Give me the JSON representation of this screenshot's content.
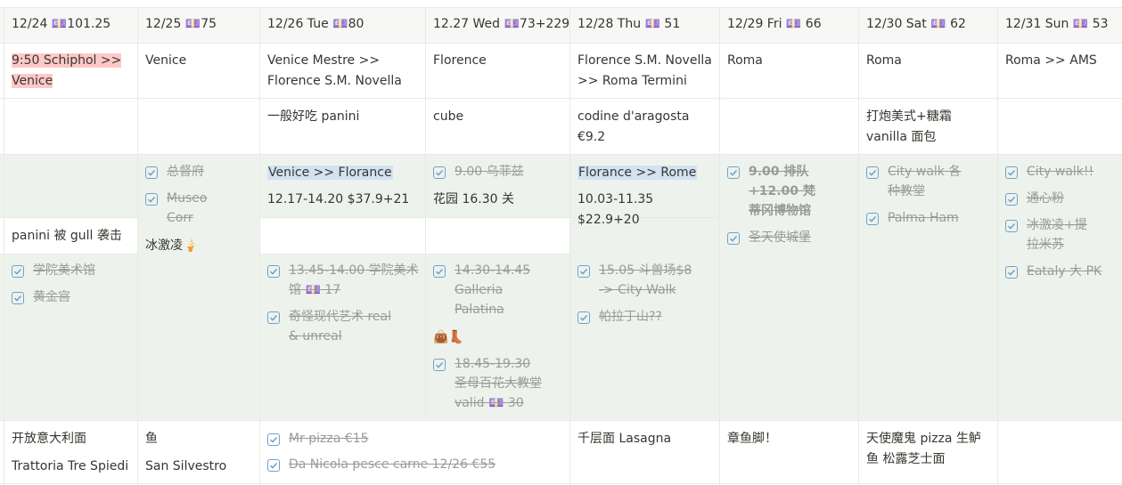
{
  "headers": [
    "12/24 💷101.25",
    "12/25 💷75",
    "12/26 Tue 💷80",
    "12.27 Wed 💷73+229",
    "12/28 Thu 💷 51",
    "12/29 Fri 💷 66",
    "12/30 Sat 💷 62",
    "12/31 Sun 💷 53"
  ],
  "transport": [
    "9:50 Schiphol >> Venice",
    "Venice",
    "Venice Mestre >> Florence S.M. Novella",
    "Florence",
    "Florence S.M. Novella >> Roma Termini",
    "Roma",
    "Roma",
    "Roma >> AMS"
  ],
  "food": [
    "",
    "",
    "一般好吃 panini",
    "cube",
    "codine d'aragosta €9.2",
    "",
    "打炮美式+糖霜 vanilla 面包",
    ""
  ],
  "activities": {
    "d1_note": "panini 被 gull 袭击",
    "d1_todos": [
      "学院美术馆",
      "黄金宫"
    ],
    "d2_todos": [
      "总督府",
      "Museo Corr"
    ],
    "d2_note": "冰激凌🍦",
    "d3_route": "Venice >> Florance",
    "d3_ticket": "12.17-14.20 $37.9+21",
    "d3_todos": [
      "13.45-14.00 学院美术馆 💷 17",
      "奇怪现代艺术 real & unreal"
    ],
    "d4_todo1": "9.00 乌菲兹",
    "d4_note": "花园 16.30 关",
    "d4_todo2": "14.30-14.45 Galleria Palatina",
    "d4_emoji": "👜👢",
    "d4_todo3": "18.45-19.30 圣母百花大教堂 valid 💷 30",
    "d5_route": "Florance >> Rome",
    "d5_ticket": "10.03-11.35 $22.9+20",
    "d5_todos": [
      "15.05 斗兽场$8 -> City Walk",
      "帕拉丁山??"
    ],
    "d6_todos": [
      "9.00 排队 +12.00 梵蒂冈博物馆",
      "圣天使城堡"
    ],
    "d7_todos": [
      "City walk 各种教堂",
      "Palma Ham"
    ],
    "d8_todos": [
      "City walk!!",
      "通心粉",
      "冰激凌+提拉米苏",
      "Eataly 大 PK"
    ]
  },
  "dinner": {
    "d1_line1": "开放意大利面",
    "d1_line2": "Trattoria Tre Spiedi",
    "d2_line1": "鱼",
    "d2_line2": "San Silvestro",
    "d34_todos": [
      "Mr pizza €15",
      "Da Nicola pesce carne 12/26 €55"
    ],
    "d5": "千层面 Lasagna",
    "d6": "章鱼脚！",
    "d7": "天使魔鬼 pizza 生鲈鱼 松露芝士面",
    "d8": ""
  },
  "colors": {
    "green_bg": "#edf3ec",
    "red_highlight": "#ffc8c8",
    "blue_highlight": "#d3e2f2",
    "checkbox": "#6fa1cc"
  }
}
